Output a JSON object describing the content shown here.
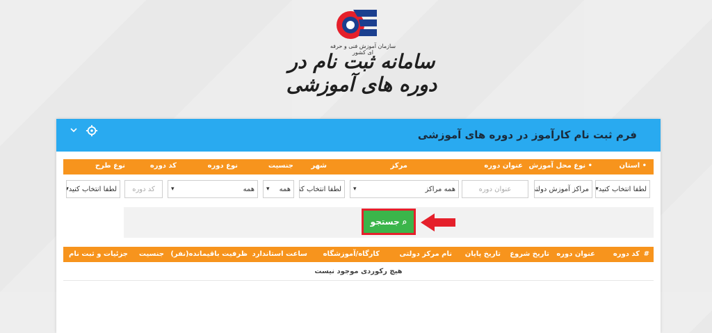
{
  "header": {
    "org_subtitle": "سازمان آموزش فنی و حرفه ای کشور",
    "site_title": "سامانه ثبت نام در دوره های آموزشی"
  },
  "panel": {
    "title": "فرم ثبت نام کارآموز در دوره های آموزشی"
  },
  "filters": {
    "headers": [
      "• استان",
      "• نوع محل آموزش",
      "عنوان دوره",
      "مرکز",
      "شهر",
      "جنسیت",
      "نوع دوره",
      "کد دوره",
      "نوع طرح"
    ],
    "province": "لطفا انتخاب کنید",
    "training_place_type": "مراکز آموزش دولتی",
    "course_title_placeholder": "عنوان دوره",
    "center": "همه مراکز",
    "city": "لطفا انتخاب کنید",
    "gender": "همه",
    "course_type": "همه",
    "course_code_placeholder": "کد دوره",
    "plan_type": "لطفا انتخاب کنید"
  },
  "search": {
    "label": "جستجو"
  },
  "results": {
    "headers": [
      "#",
      "کد دوره",
      "عنوان دوره",
      "تاریخ شروع",
      "تاریخ پایان",
      "نام مرکز دولتی",
      "کارگاه/آموزشگاه",
      "ساعت استاندارد",
      "ظرفیت باقیمانده(نفر)",
      "جنسیت",
      "جزئیات و ثبت نام"
    ],
    "empty_message": "هیچ رکوردی موجود نیست"
  },
  "colors": {
    "panel_header": "#29aaf0",
    "table_header": "#f7941d",
    "search_button": "#3bb54a",
    "highlight": "#e5202b"
  }
}
